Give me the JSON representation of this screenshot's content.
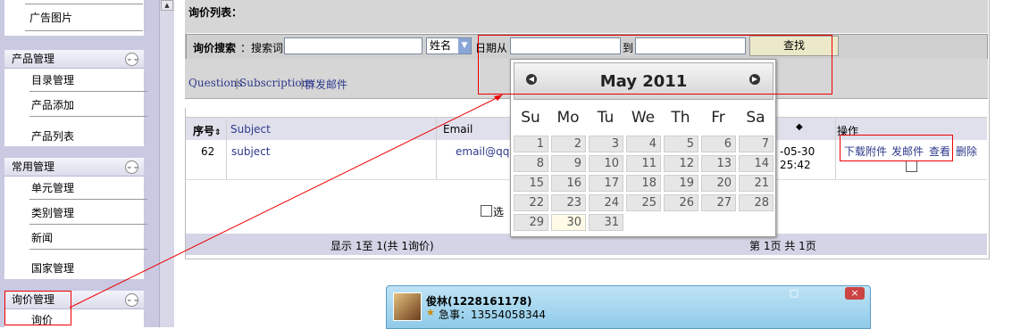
{
  "sidebar": {
    "top_item": "广告图片",
    "sections": [
      {
        "title": "产品管理",
        "items": [
          "目录管理",
          "产品添加",
          "产品列表"
        ]
      },
      {
        "title": "常用管理",
        "items": [
          "单元管理",
          "类别管理",
          "新闻",
          "国家管理"
        ]
      },
      {
        "title": "询价管理",
        "items": [
          "询价"
        ]
      }
    ]
  },
  "list": {
    "title": "询价列表：",
    "search": {
      "label": "询价搜索",
      "keyword_label": "：搜索词",
      "keyword_value": "",
      "field_select": "姓名",
      "date_from_label": "日期从",
      "date_to_label": "到",
      "submit_label": "查找"
    },
    "links": {
      "questions": "Questions",
      "sep1": "|",
      "subscriptions": "Subscriptions",
      "sep2": "|",
      "mass_mail": "群发邮件"
    },
    "table": {
      "headers": [
        "序号",
        "Subject",
        "Email",
        "",
        "操作"
      ],
      "rows": [
        {
          "id": "62",
          "subject": "subject",
          "email": "email@qq.",
          "date": "-05-30",
          "time": "25:42",
          "actions": [
            "下载附件",
            "发邮件",
            "查看",
            "删除"
          ]
        }
      ]
    },
    "select_label": "选",
    "footer": {
      "summary": "显示 1至 1(共 1询价)",
      "pagination": "第 1页 共 1页"
    }
  },
  "calendar": {
    "month_label": "May 2011",
    "weekdays": [
      "Su",
      "Mo",
      "Tu",
      "We",
      "Th",
      "Fr",
      "Sa"
    ],
    "days": [
      [
        "1",
        "2",
        "3",
        "4",
        "5",
        "6",
        "7"
      ],
      [
        "8",
        "9",
        "10",
        "11",
        "12",
        "13",
        "14"
      ],
      [
        "15",
        "16",
        "17",
        "18",
        "19",
        "20",
        "21"
      ],
      [
        "22",
        "23",
        "24",
        "25",
        "26",
        "27",
        "28"
      ],
      [
        "29",
        "30",
        "31",
        "",
        "",
        "",
        ""
      ]
    ],
    "highlighted_day": "30"
  },
  "qq_window": {
    "contact_name": "俊林(1228161178)",
    "status": "急事：13554058344",
    "buttons": [
      "□",
      "×"
    ]
  }
}
